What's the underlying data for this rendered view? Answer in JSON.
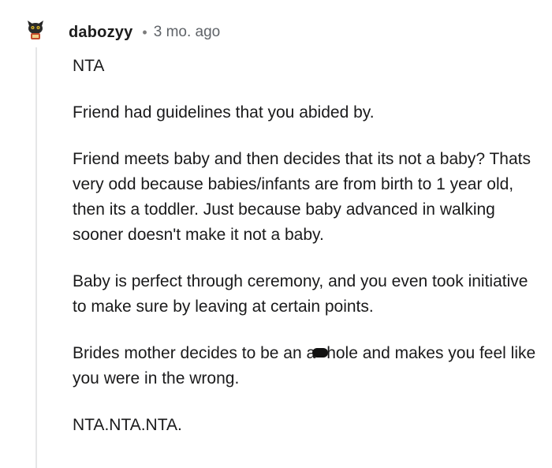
{
  "comment": {
    "username": "dabozyy",
    "separator": "•",
    "time": "3 mo. ago",
    "avatar_icon": "snoo-avatar-icon",
    "paragraphs": {
      "p1": "NTA",
      "p2": "Friend had guidelines that you abided by.",
      "p3": "Friend meets baby and then decides that its not a baby? Thats very odd because babies/infants are from birth to 1 year old, then its a toddler. Just because baby advanced in walking sooner doesn't make it not a baby.",
      "p4": "Baby is perfect through ceremony, and you even took initiative to make sure by leaving at certain points.",
      "p5_before": "Brides mother decides to be an a",
      "p5_after": "hole and makes you feel like you were in the wrong.",
      "p6": "NTA.NTA.NTA."
    }
  },
  "colors": {
    "text": "#1a1a1b",
    "meta": "#5f6368",
    "thread_line": "#e5e6e7",
    "censor_mark": "#111111"
  }
}
